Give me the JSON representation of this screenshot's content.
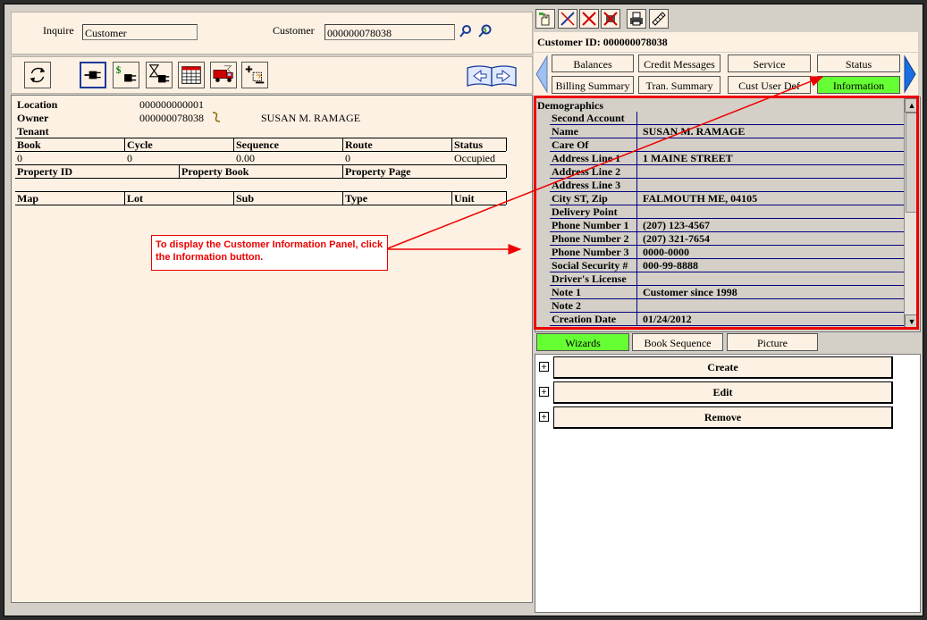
{
  "inquire": {
    "inquire_label": "Inquire",
    "inquire_value": "Customer",
    "customer_label": "Customer",
    "customer_value": "000000078038"
  },
  "location_info": {
    "location_label": "Location",
    "location_value": "000000000001",
    "owner_label": "Owner",
    "owner_value": "000000078038",
    "owner_name": "SUSAN M. RAMAGE",
    "tenant_label": "Tenant"
  },
  "grid1": {
    "headers": [
      "Book",
      "Cycle",
      "Sequence",
      "Route",
      "Status"
    ],
    "values": [
      "0",
      "0",
      "0.00",
      "0",
      "Occupied"
    ]
  },
  "grid2": {
    "headers": [
      "Property ID",
      "Property Book",
      "Property Page"
    ]
  },
  "grid3": {
    "headers": [
      "Map",
      "Lot",
      "Sub",
      "Type",
      "Unit"
    ]
  },
  "customer_id": "Customer ID: 000000078038",
  "tabs": {
    "row1": [
      "Balances",
      "Credit Messages",
      "Service",
      "Status"
    ],
    "row2": [
      "Billing Summary",
      "Tran. Summary",
      "Cust User Def",
      "Information"
    ],
    "active": "Information"
  },
  "demographics": {
    "title": "Demographics",
    "rows": [
      {
        "label": "Second Account",
        "value": ""
      },
      {
        "label": "Name",
        "value": "SUSAN M. RAMAGE"
      },
      {
        "label": "Care Of",
        "value": ""
      },
      {
        "label": "Address Line 1",
        "value": "1 MAINE STREET"
      },
      {
        "label": "Address Line 2",
        "value": ""
      },
      {
        "label": "Address Line 3",
        "value": ""
      },
      {
        "label": "City ST, Zip",
        "value": "FALMOUTH ME, 04105"
      },
      {
        "label": "Delivery Point",
        "value": ""
      },
      {
        "label": "Phone Number 1",
        "value": "(207) 123-4567"
      },
      {
        "label": "Phone Number 2",
        "value": "(207) 321-7654"
      },
      {
        "label": "Phone Number 3",
        "value": "0000-0000"
      },
      {
        "label": "Social Security #",
        "value": "000-99-8888"
      },
      {
        "label": "Driver's License",
        "value": ""
      },
      {
        "label": "Note 1",
        "value": "Customer since 1998"
      },
      {
        "label": "Note 2",
        "value": ""
      },
      {
        "label": "Creation Date",
        "value": "01/24/2012"
      }
    ]
  },
  "bottom_tabs": [
    "Wizards",
    "Book Sequence",
    "Picture"
  ],
  "wizards": [
    "Create",
    "Edit",
    "Remove"
  ],
  "callout_text": "To display the Customer Information Panel, click the Information button.",
  "colors": {
    "active_tab": "#66ff33",
    "panel_bg": "#fdf1e3",
    "callout": "#ee0000",
    "row_line": "#000080"
  },
  "icons": {
    "left_toolbar": [
      "refresh-icon",
      "plug-icon",
      "money-plug-icon",
      "hourglass-plug-icon",
      "calendar-icon",
      "truck-icon",
      "add-field-icon",
      "book-nav-icon"
    ],
    "right_toolbar": [
      "hand-icon",
      "cut-icon",
      "delete-icon",
      "disconnect-icon",
      "print-icon",
      "tools-icon"
    ]
  }
}
